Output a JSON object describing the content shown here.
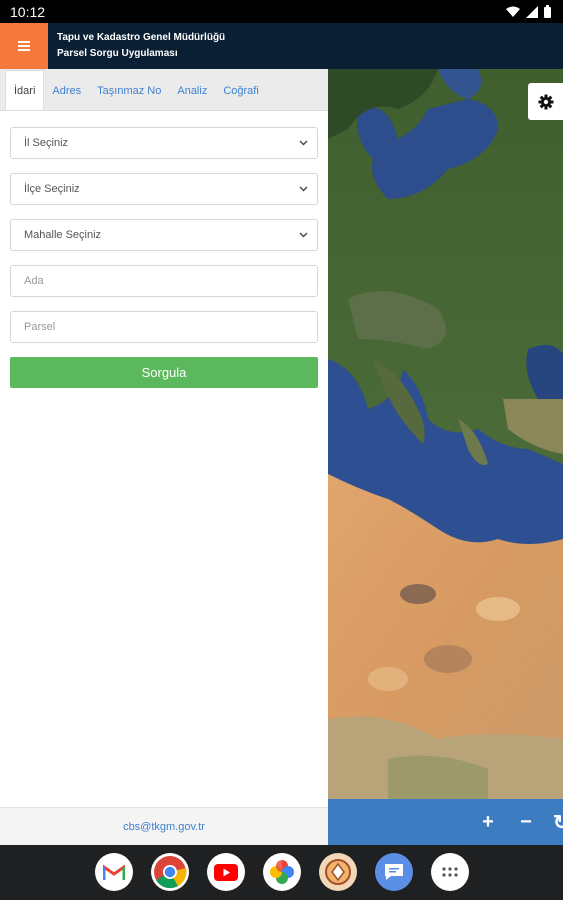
{
  "status": {
    "time": "10:12"
  },
  "header": {
    "line1": "Tapu ve Kadastro Genel Müdürlüğü",
    "line2": "Parsel Sorgu Uygulaması"
  },
  "tabs": [
    {
      "label": "İdari",
      "active": true
    },
    {
      "label": "Adres"
    },
    {
      "label": "Taşınmaz No"
    },
    {
      "label": "Analiz"
    },
    {
      "label": "Coğrafi"
    }
  ],
  "form": {
    "il": "İl Seçiniz",
    "ilce": "İlçe Seçiniz",
    "mahalle": "Mahalle Seçiniz",
    "ada_placeholder": "Ada",
    "parsel_placeholder": "Parsel",
    "submit": "Sorgula"
  },
  "footer": {
    "email": "cbs@tkgm.gov.tr"
  },
  "map": {
    "tools": [
      "+",
      "−",
      "↻"
    ]
  },
  "dock": [
    "gmail-icon",
    "chrome-icon",
    "youtube-icon",
    "photos-icon",
    "app-icon",
    "messages-icon",
    "apps-grid-icon"
  ],
  "colors": {
    "accent": "#f4793b",
    "header": "#0a1f33",
    "primary": "#5cb85c",
    "link": "#3d82d1",
    "toolbar": "#3d7cc1"
  }
}
